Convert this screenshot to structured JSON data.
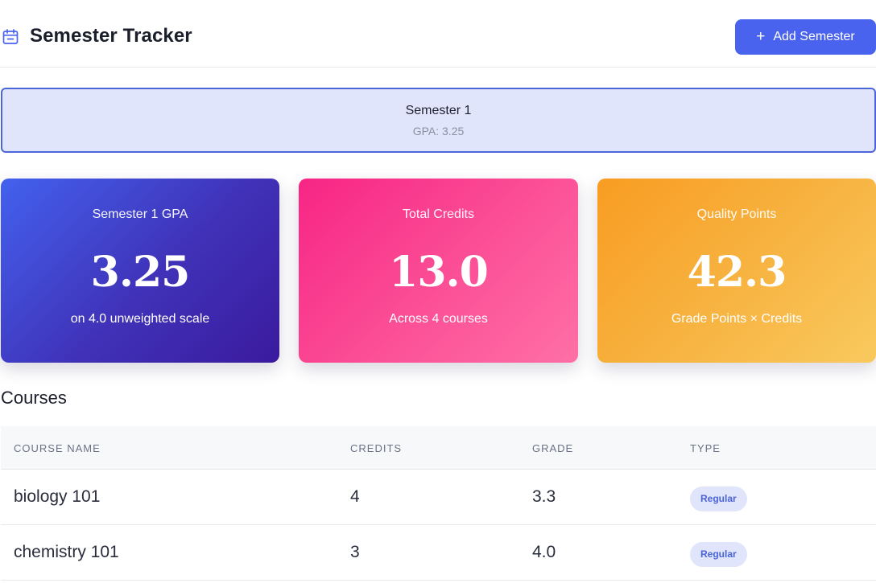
{
  "header": {
    "title": "Semester Tracker",
    "add_button_label": "Add Semester"
  },
  "semesters": [
    {
      "name": "Semester 1",
      "gpa_text": "GPA: 3.25",
      "selected": true
    }
  ],
  "stats": {
    "gpa": {
      "label": "Semester 1 GPA",
      "value": "3.25",
      "sub": "on 4.0 unweighted scale"
    },
    "credits": {
      "label": "Total Credits",
      "value": "13.0",
      "sub": "Across 4 courses"
    },
    "quality_points": {
      "label": "Quality Points",
      "value": "42.3",
      "sub": "Grade Points × Credits"
    }
  },
  "courses": {
    "title": "Courses",
    "columns": [
      "Course Name",
      "Credits",
      "Grade",
      "Type"
    ],
    "rows": [
      {
        "name": "biology 101",
        "credits": "4",
        "grade": "3.3",
        "type": "Regular"
      },
      {
        "name": "chemistry 101",
        "credits": "3",
        "grade": "4.0",
        "type": "Regular"
      }
    ]
  },
  "colors": {
    "accent": "#4a63ee",
    "gpa_card": "#4361ee",
    "credits_card": "#f72585",
    "points_card": "#f89c22"
  },
  "icons": {
    "header_icon": "calendar-icon",
    "add_icon": "plus-icon"
  }
}
